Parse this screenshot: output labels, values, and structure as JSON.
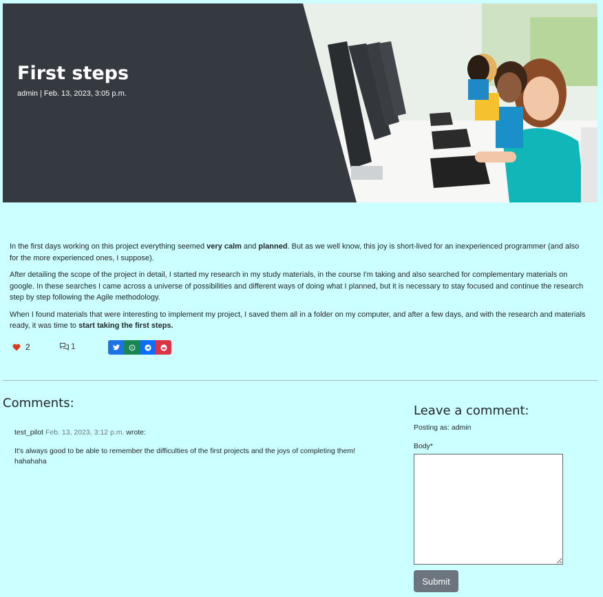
{
  "post": {
    "title": "First steps",
    "meta": "admin | Feb. 13, 2023, 3:05 p.m.",
    "featured_image_alt": "children working at computers"
  },
  "content": {
    "p1_a": "In the first days working on this project everything seemed ",
    "p1_b": "very calm",
    "p1_c": " and ",
    "p1_d": "planned",
    "p1_e": ". But as we well know, this joy is short-lived for an inexperienced programmer (and also for the more experienced ones, I suppose).",
    "p2": "After detailing the scope of the project in detail, I started my research in my study materials, in the course I'm taking and also searched for complementary materials on google. In these searches I came across a universe of possibilities and different ways of doing what I planned, but it is necessary to stay focused and continue the research step by step following the Agile methodology.",
    "p3_a": "When I found materials that were interesting to implement my project, I saved them all in a folder on my computer, and after a few days, and with the research and materials ready, it was time to ",
    "p3_b": "start taking the first steps.",
    "p3_c": ""
  },
  "actions": {
    "likes_count": "2",
    "comments_count": "1",
    "like_icon": "heart-icon",
    "comment_icon": "chat-bubbles-icon",
    "share": [
      {
        "icon": "twitter-icon",
        "color": "#1d72e8"
      },
      {
        "icon": "whatsapp-icon",
        "color": "#198754"
      },
      {
        "icon": "telegram-icon",
        "color": "#0d6efd"
      },
      {
        "icon": "reddit-icon",
        "color": "#dc3545"
      }
    ]
  },
  "comments": {
    "heading": "Comments:",
    "items": [
      {
        "author": "test_pilot",
        "date": "Feb. 13, 2023, 3:12 p.m.",
        "wrote": "wrote:",
        "body": "It's always good to be able to remember the difficulties of the first projects and the joys of completing them! hahahaha"
      }
    ]
  },
  "form": {
    "heading": "Leave a comment:",
    "posting_as": "Posting as: admin",
    "body_label": "Body*",
    "body_value": "",
    "submit_label": "Submit"
  },
  "colors": {
    "page_bg": "#ccffff",
    "hero_bg": "#343a40",
    "like": "#d63c1a",
    "submit_bg": "#6c757d"
  }
}
